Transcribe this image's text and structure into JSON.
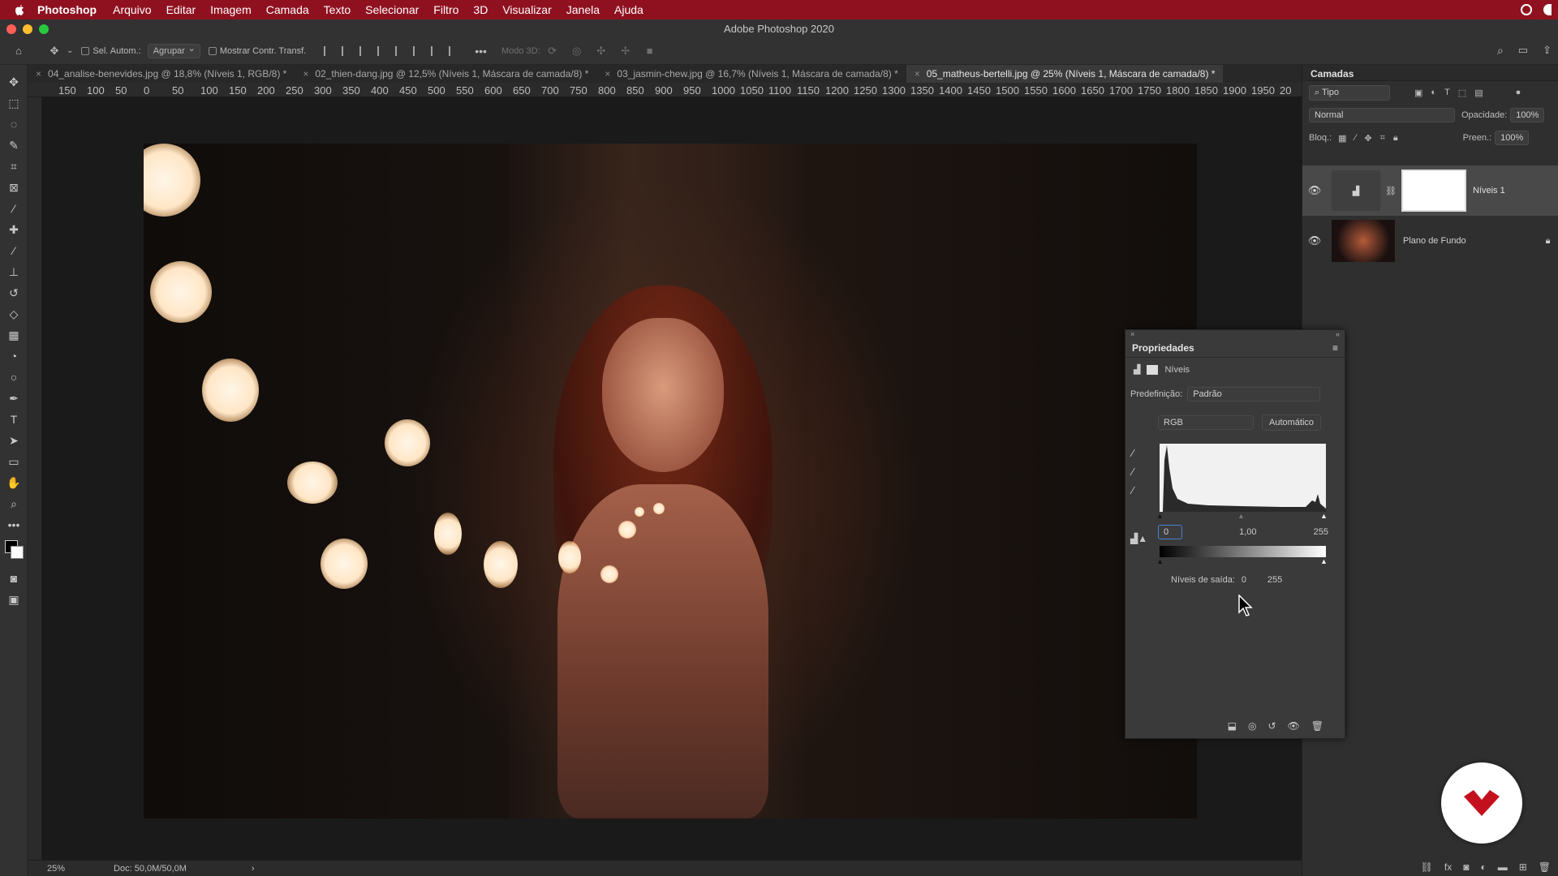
{
  "menubar": {
    "app": "Photoshop",
    "items": [
      "Arquivo",
      "Editar",
      "Imagem",
      "Camada",
      "Texto",
      "Selecionar",
      "Filtro",
      "3D",
      "Visualizar",
      "Janela",
      "Ajuda"
    ]
  },
  "window": {
    "title": "Adobe Photoshop 2020"
  },
  "options": {
    "auto_select": "Sel. Autom.:",
    "group": "Agrupar",
    "show_transform": "Mostrar Contr. Transf.",
    "mode3d": "Modo 3D:"
  },
  "tabs": [
    {
      "label": "04_analise-benevides.jpg @ 18,8% (Níveis 1, RGB/8) *"
    },
    {
      "label": "02_thien-dang.jpg @ 12,5% (Níveis 1, Máscara de camada/8) *"
    },
    {
      "label": "03_jasmin-chew.jpg @ 16,7% (Níveis 1, Máscara de camada/8) *"
    },
    {
      "label": "05_matheus-bertelli.jpg @ 25% (Níveis 1, Máscara de camada/8) *"
    }
  ],
  "ruler_ticks": [
    "150",
    "100",
    "50",
    "0",
    "50",
    "100",
    "150",
    "200",
    "250",
    "300",
    "350",
    "400",
    "450",
    "500",
    "550",
    "600",
    "650",
    "700",
    "750",
    "800",
    "850",
    "900",
    "950",
    "1000",
    "1050",
    "1100",
    "1150",
    "1200",
    "1250",
    "1300",
    "1350",
    "1400",
    "1450",
    "1500",
    "1550",
    "1600",
    "1650",
    "1700",
    "1750",
    "1800",
    "1850",
    "1900",
    "1950",
    "20"
  ],
  "status": {
    "zoom": "25%",
    "doc": "Doc: 50,0M/50,0M"
  },
  "layers_panel": {
    "title": "Camadas",
    "filter": "Tipo",
    "blend": "Normal",
    "opacity_label": "Opacidade:",
    "opacity": "100%",
    "lock_label": "Bloq.:",
    "fill_label": "Preen.:",
    "fill": "100%",
    "layers": [
      {
        "name": "Níveis 1"
      },
      {
        "name": "Plano de Fundo"
      }
    ]
  },
  "properties": {
    "title": "Propriedades",
    "adjustment": "Níveis",
    "preset_label": "Predefinição:",
    "preset": "Padrão",
    "channel": "RGB",
    "auto_button": "Automático",
    "input_black": "0",
    "input_gamma": "1,00",
    "input_white": "255",
    "output_label": "Níveis de saída:",
    "output_black": "0",
    "output_white": "255"
  },
  "colors": {
    "menubar": "#8f1120",
    "accent_logo": "#c4101e"
  }
}
